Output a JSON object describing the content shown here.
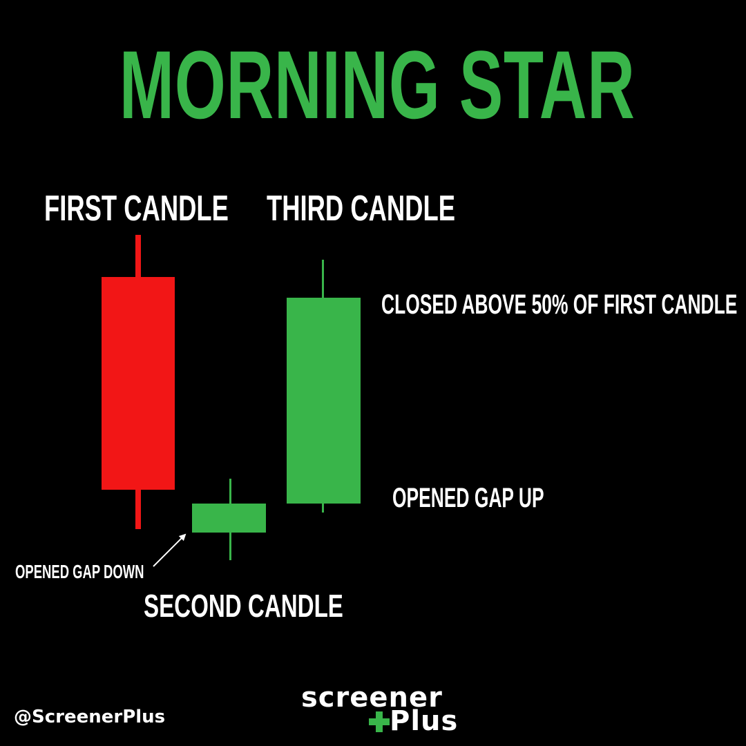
{
  "title": "MORNING STAR",
  "colors": {
    "background": "#000000",
    "title": "#39b54a",
    "bearish": "#f21616",
    "bullish": "#39b54a",
    "text": "#ffffff"
  },
  "labels": {
    "first_candle": "FIRST CANDLE",
    "second_candle": "SECOND CANDLE",
    "third_candle": "THIRD CANDLE",
    "closed_above": "CLOSED ABOVE 50% OF FIRST CANDLE",
    "opened_gap_up": "OPENED GAP UP",
    "opened_gap_down": "OPENED GAP DOWN"
  },
  "candles": [
    {
      "name": "first",
      "direction": "bearish"
    },
    {
      "name": "second",
      "direction": "bullish"
    },
    {
      "name": "third",
      "direction": "bullish"
    }
  ],
  "footer": {
    "handle": "@ScreenerPlus",
    "logo_line1": "screener",
    "logo_line2": "Plus",
    "logo_icon": "plus-icon"
  }
}
